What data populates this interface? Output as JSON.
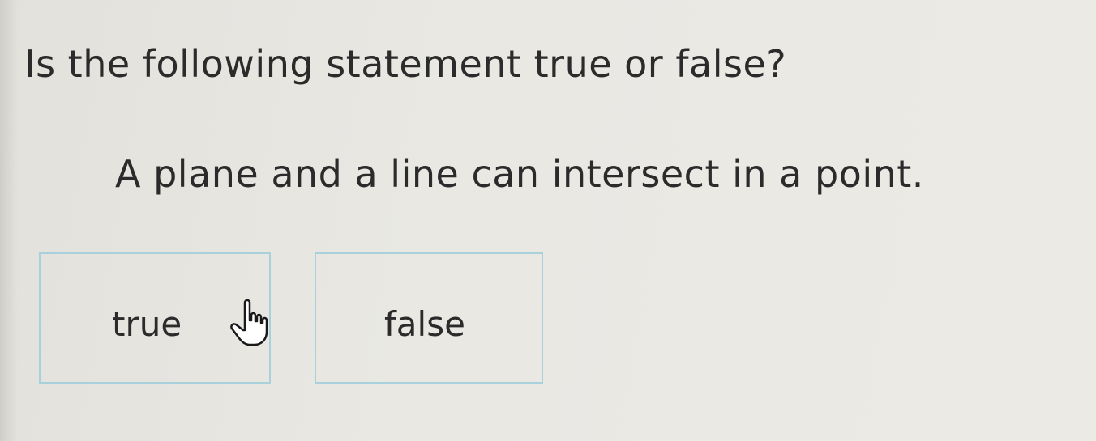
{
  "prompt": {
    "question": "Is the following statement true or false?",
    "statement": "A plane and a line can intersect in a point."
  },
  "choices": [
    {
      "label": "true"
    },
    {
      "label": "false"
    }
  ],
  "cursor": {
    "icon": "hand-pointer-icon"
  },
  "colors": {
    "choice_border": "#a9d1dc",
    "text": "#2b2b2b",
    "background": "#e9e8e3"
  }
}
